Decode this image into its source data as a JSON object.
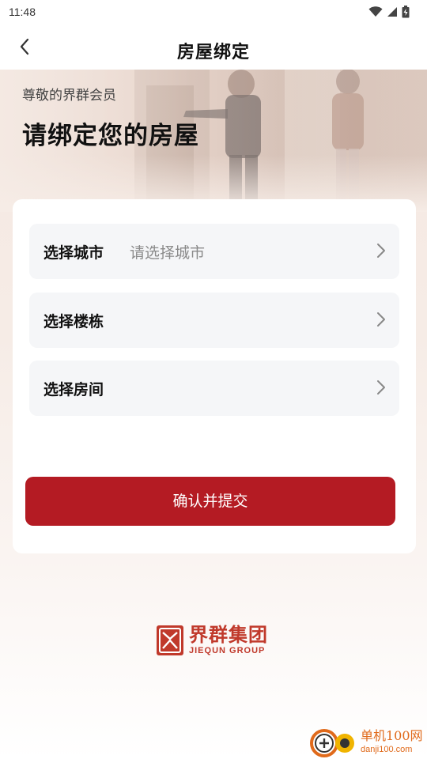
{
  "status_bar": {
    "time": "11:48",
    "icons": [
      "wifi-icon",
      "signal-icon",
      "battery-icon"
    ]
  },
  "nav": {
    "title": "房屋绑定",
    "back_icon": "chevron-left-icon"
  },
  "hero": {
    "subtitle": "尊敬的界群会员",
    "title": "请绑定您的房屋"
  },
  "form": {
    "rows": [
      {
        "label": "选择城市",
        "placeholder": "请选择城市",
        "icon": "chevron-right-icon"
      },
      {
        "label": "选择楼栋",
        "placeholder": "",
        "icon": "chevron-right-icon"
      },
      {
        "label": "选择房间",
        "placeholder": "",
        "icon": "chevron-right-icon"
      }
    ],
    "submit_label": "确认并提交"
  },
  "brand": {
    "name_cn": "界群集团",
    "name_en": "JIEQUN GROUP",
    "color": "#c0392b"
  },
  "watermark": {
    "name_cn": "单机100网",
    "url": "danji100.com",
    "color": "#e06a1b"
  },
  "colors": {
    "primary": "#b41b23",
    "row_bg": "#f5f6f8",
    "placeholder": "#8a8a8a"
  }
}
